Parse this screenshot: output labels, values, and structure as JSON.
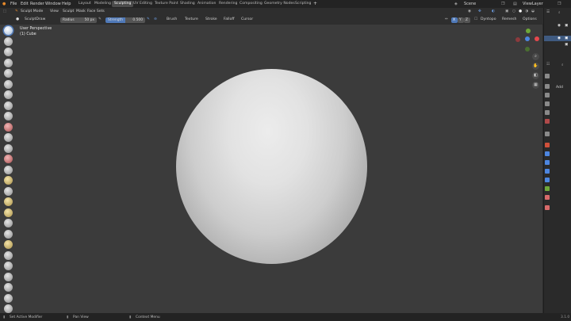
{
  "menu": {
    "file": "File",
    "edit": "Edit",
    "render": "Render",
    "window": "Window",
    "help": "Help"
  },
  "workspaces": [
    "Layout",
    "Modeling",
    "Sculpting",
    "UV Editing",
    "Texture Paint",
    "Shading",
    "Animation",
    "Rendering",
    "Compositing",
    "Geometry Nodes",
    "Scripting"
  ],
  "active_workspace": "Sculpting",
  "scene": "Scene",
  "view_layer": "ViewLayer",
  "header": {
    "mode": "Sculpt Mode",
    "view": "View",
    "sculpt": "Sculpt",
    "mask": "Mask",
    "face_sets": "Face Sets"
  },
  "tool_header": {
    "tool": "SculptDraw",
    "radius_label": "Radius",
    "radius_value": "50 px",
    "strength_label": "Strength",
    "strength_value": "0.500",
    "brush": "Brush",
    "texture": "Texture",
    "stroke": "Stroke",
    "falloff": "Falloff",
    "cursor": "Cursor",
    "x": "X",
    "y": "Y",
    "z": "Z",
    "dyntopo": "Dyntopo",
    "remesh": "Remesh",
    "options": "Options"
  },
  "viewport": {
    "perspective": "User Perspective",
    "object": "(1) Cube"
  },
  "gizmo": {
    "x_label": "X",
    "y_label": "Y",
    "z_label": "Z",
    "x_color": "#e5484d",
    "y_color": "#6ea839",
    "z_color": "#4d86e0"
  },
  "side_panel": {
    "add_label": "Add"
  },
  "status": {
    "left": "Set Active Modifier",
    "mid": "Pan View",
    "right": "Context Menu",
    "version": "3.1.0"
  },
  "accent": "#4f79b8"
}
